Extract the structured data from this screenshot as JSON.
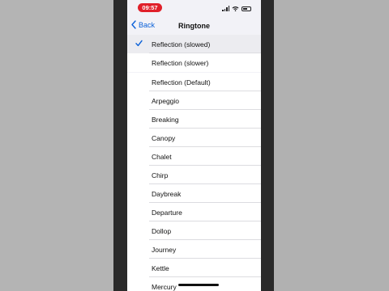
{
  "status_bar": {
    "time": "09:57"
  },
  "nav": {
    "back_label": "Back",
    "title": "Ringtone"
  },
  "top_group": [
    {
      "label": "Reflection (slowed)",
      "selected": true
    },
    {
      "label": "Reflection (slower)",
      "selected": false
    }
  ],
  "ringtones": [
    "Reflection (Default)",
    "Arpeggio",
    "Breaking",
    "Canopy",
    "Chalet",
    "Chirp",
    "Daybreak",
    "Departure",
    "Dollop",
    "Journey",
    "Kettle",
    "Mercury"
  ],
  "colors": {
    "accent": "#0a60d8",
    "time_pill": "#e0202a",
    "background": "#f2f2f7"
  }
}
